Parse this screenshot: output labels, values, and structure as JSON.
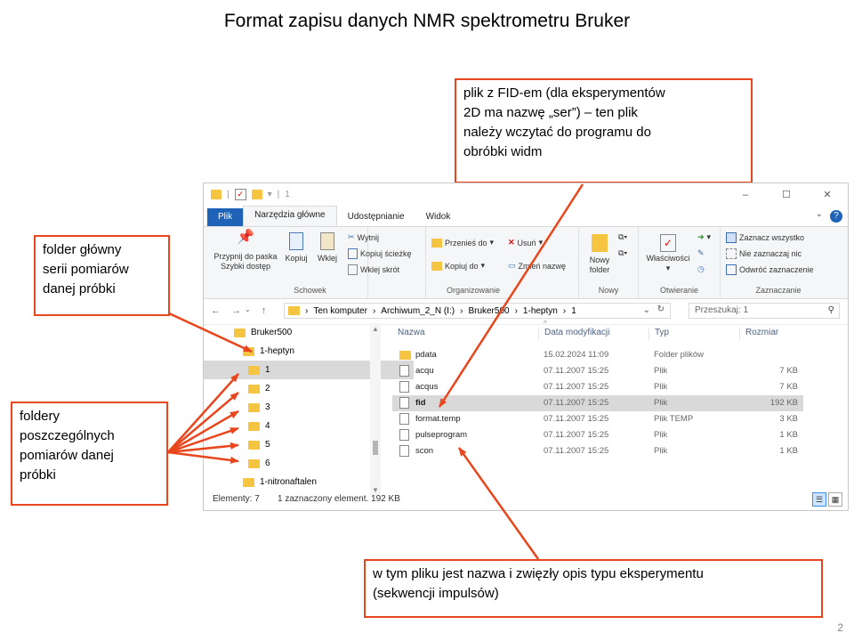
{
  "slide": {
    "title": "Format zapisu danych NMR spektrometru Bruker",
    "page_number": "2"
  },
  "callouts": {
    "fid_note": "plik z FID-em (dla eksperymentów\n2D ma nazwę „ser”) – ten plik\nnależy wczytać do programu do\nobróbki widm",
    "main_folder": "folder główny\nserii pomiarów\ndanej próbki",
    "sub_folders": "foldery\nposzczególnych\npomiarów danej\npróbki",
    "pulseprogram_note": "w tym pliku jest nazwa i zwięzły opis typu eksperymentu\n(sekwencji impulsów)",
    "arrow_color": "#e8461c"
  },
  "window": {
    "title": "1",
    "controls": [
      "–",
      "☐",
      "✕"
    ]
  },
  "ribbon": {
    "tabs": [
      "Plik",
      "Narzędzia główne",
      "Udostępnianie",
      "Widok"
    ],
    "help": "?",
    "clipboard": {
      "pin": "Przypnij do paska Szybki dostęp",
      "copy": "Kopiuj",
      "paste": "Wklej",
      "cut": "Wytnij",
      "copy_path": "Kopiuj ścieżkę",
      "paste_shortcut": "Wklej skrót",
      "label": "Schowek"
    },
    "organize": {
      "move_to": "Przenieś do",
      "copy_to": "Kopiuj do",
      "delete": "Usuń",
      "rename": "Zmień nazwę",
      "label": "Organizowanie"
    },
    "new": {
      "new_folder": "Nowy folder",
      "label": "Nowy"
    },
    "open": {
      "properties": "Właściwości",
      "label": "Otwieranie"
    },
    "select": {
      "select_all": "Zaznacz wszystko",
      "select_none": "Nie zaznaczaj nic",
      "invert": "Odwróć zaznaczenie",
      "label": "Zaznaczanie"
    }
  },
  "address": {
    "crumbs": [
      "Ten komputer",
      "Archiwum_2_N (I:)",
      "Bruker500",
      "1-heptyn",
      "1"
    ],
    "search_placeholder": "Przeszukaj: 1"
  },
  "tree": [
    {
      "label": "Bruker500",
      "selected": false
    },
    {
      "label": "1-heptyn",
      "selected": false
    },
    {
      "label": "1",
      "selected": true
    },
    {
      "label": "2",
      "selected": false
    },
    {
      "label": "3",
      "selected": false
    },
    {
      "label": "4",
      "selected": false
    },
    {
      "label": "5",
      "selected": false
    },
    {
      "label": "6",
      "selected": false
    },
    {
      "label": "1-nitronaftalen",
      "selected": false
    }
  ],
  "files": {
    "columns": [
      "Nazwa",
      "Data modyfikacji",
      "Typ",
      "Rozmiar"
    ],
    "rows": [
      {
        "name": "pdata",
        "date": "15.02.2024 11:09",
        "type": "Folder plików",
        "size": "",
        "folder": true,
        "selected": false
      },
      {
        "name": "acqu",
        "date": "07.11.2007 15:25",
        "type": "Plik",
        "size": "7 KB",
        "folder": false,
        "selected": false
      },
      {
        "name": "acqus",
        "date": "07.11.2007 15:25",
        "type": "Plik",
        "size": "7 KB",
        "folder": false,
        "selected": false
      },
      {
        "name": "fid",
        "date": "07.11.2007 15:25",
        "type": "Plik",
        "size": "192 KB",
        "folder": false,
        "selected": true
      },
      {
        "name": "format.temp",
        "date": "07.11.2007 15:25",
        "type": "Plik TEMP",
        "size": "3 KB",
        "folder": false,
        "selected": false
      },
      {
        "name": "pulseprogram",
        "date": "07.11.2007 15:25",
        "type": "Plik",
        "size": "1 KB",
        "folder": false,
        "selected": false
      },
      {
        "name": "scon",
        "date": "07.11.2007 15:25",
        "type": "Plik",
        "size": "1 KB",
        "folder": false,
        "selected": false
      }
    ]
  },
  "status": {
    "count": "Elementy: 7",
    "selection": "1 zaznaczony element. 192 KB"
  }
}
